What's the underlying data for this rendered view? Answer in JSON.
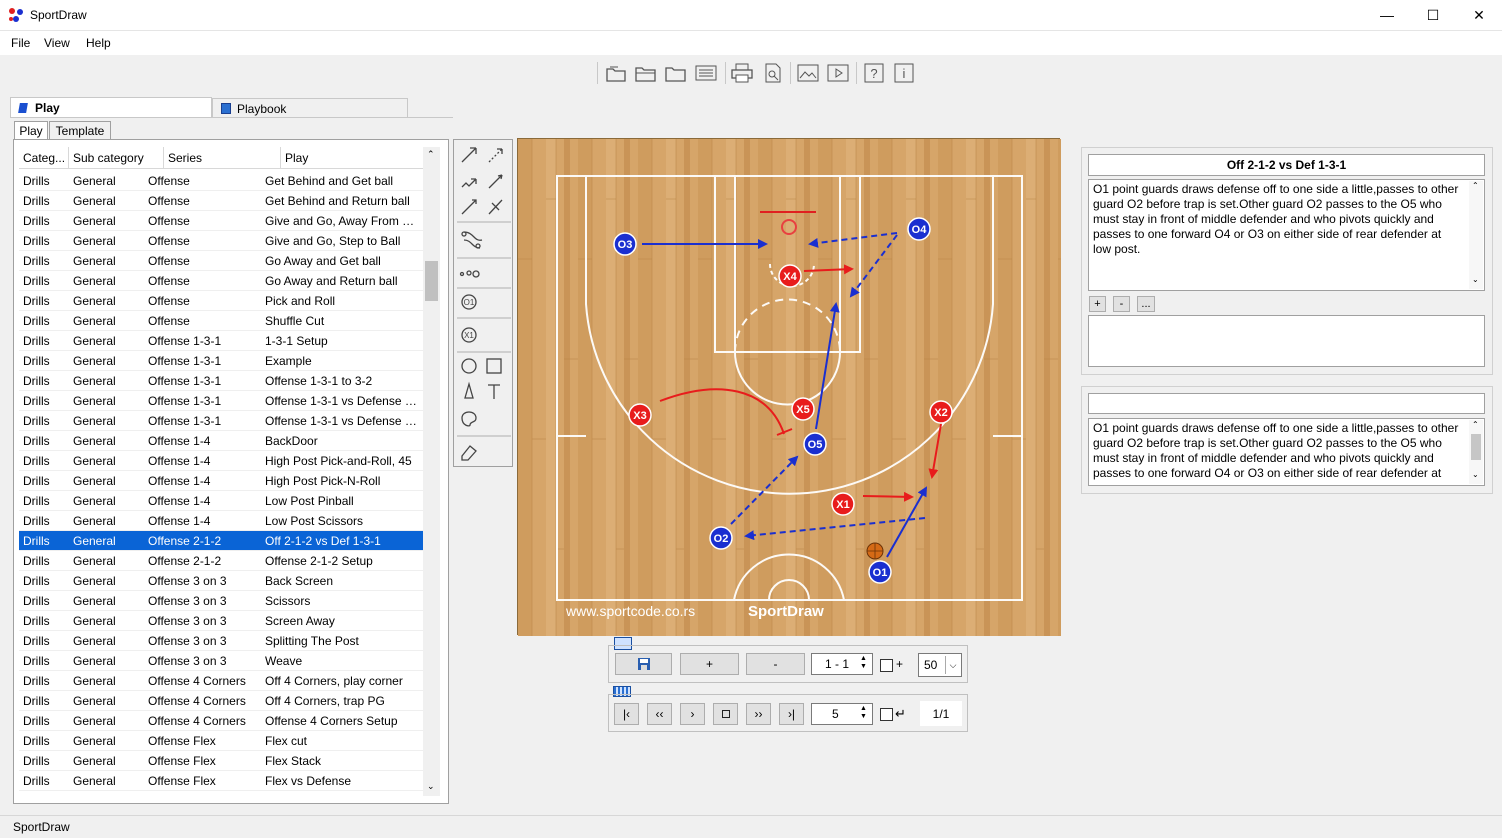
{
  "window": {
    "title": "SportDraw"
  },
  "menu": [
    "File",
    "View",
    "Help"
  ],
  "tabs": {
    "outer": [
      "Play",
      "Playbook"
    ],
    "inner": [
      "Play",
      "Template"
    ]
  },
  "list": {
    "columns": [
      "Categ...",
      "Sub category",
      "Series",
      "Play"
    ],
    "rows": [
      [
        "Drills",
        "General",
        "Offense",
        "Get Behind and Get ball"
      ],
      [
        "Drills",
        "General",
        "Offense",
        "Get Behind and Return ball"
      ],
      [
        "Drills",
        "General",
        "Offense",
        "Give and Go, Away From Ball"
      ],
      [
        "Drills",
        "General",
        "Offense",
        "Give and Go, Step to Ball"
      ],
      [
        "Drills",
        "General",
        "Offense",
        "Go Away and Get ball"
      ],
      [
        "Drills",
        "General",
        "Offense",
        "Go Away and Return ball"
      ],
      [
        "Drills",
        "General",
        "Offense",
        "Pick and Roll"
      ],
      [
        "Drills",
        "General",
        "Offense",
        "Shuffle Cut"
      ],
      [
        "Drills",
        "General",
        "Offense 1-3-1",
        "1-3-1 Setup"
      ],
      [
        "Drills",
        "General",
        "Offense 1-3-1",
        "Example"
      ],
      [
        "Drills",
        "General",
        "Offense 1-3-1",
        "Offense 1-3-1 to 3-2"
      ],
      [
        "Drills",
        "General",
        "Offense 1-3-1",
        "Offense 1-3-1 vs Defense 2-..."
      ],
      [
        "Drills",
        "General",
        "Offense 1-3-1",
        "Offense 1-3-1 vs Defense 3-..."
      ],
      [
        "Drills",
        "General",
        "Offense 1-4",
        "BackDoor"
      ],
      [
        "Drills",
        "General",
        "Offense 1-4",
        "High Post Pick-and-Roll, 45"
      ],
      [
        "Drills",
        "General",
        "Offense 1-4",
        "High Post Pick-N-Roll"
      ],
      [
        "Drills",
        "General",
        "Offense 1-4",
        "Low Post Pinball"
      ],
      [
        "Drills",
        "General",
        "Offense 1-4",
        "Low Post Scissors"
      ],
      [
        "Drills",
        "General",
        "Offense 2-1-2",
        "Off  2-1-2 vs Def 1-3-1"
      ],
      [
        "Drills",
        "General",
        "Offense 2-1-2",
        "Offense 2-1-2 Setup"
      ],
      [
        "Drills",
        "General",
        "Offense 3 on 3",
        "Back Screen"
      ],
      [
        "Drills",
        "General",
        "Offense 3 on 3",
        "Scissors"
      ],
      [
        "Drills",
        "General",
        "Offense 3 on 3",
        "Screen Away"
      ],
      [
        "Drills",
        "General",
        "Offense 3 on 3",
        "Splitting The Post"
      ],
      [
        "Drills",
        "General",
        "Offense 3 on 3",
        "Weave"
      ],
      [
        "Drills",
        "General",
        "Offense 4 Corners",
        "Off 4 Corners, play corner"
      ],
      [
        "Drills",
        "General",
        "Offense 4 Corners",
        "Off 4 Corners, trap PG"
      ],
      [
        "Drills",
        "General",
        "Offense 4 Corners",
        "Offense 4 Corners Setup"
      ],
      [
        "Drills",
        "General",
        "Offense Flex",
        "Flex cut"
      ],
      [
        "Drills",
        "General",
        "Offense Flex",
        "Flex Stack"
      ],
      [
        "Drills",
        "General",
        "Offense Flex",
        "Flex vs Defense"
      ]
    ],
    "selected_play": "Off  2-1-2 vs Def 1-3-1"
  },
  "court": {
    "watermark_left": "www.sportcode.co.rs",
    "watermark_right": "SportDraw",
    "players": {
      "O1": "O1",
      "O2": "O2",
      "O3": "O3",
      "O4": "O4",
      "O5": "O5",
      "X1": "X1",
      "X2": "X2",
      "X3": "X3",
      "X4": "X4",
      "X5": "X5"
    }
  },
  "controls": {
    "add_label": "+",
    "remove_label": "-",
    "frame_value": "1 - 1",
    "plus_check_label": "+",
    "zoom_value": "50",
    "speed_value": "5",
    "page_value": "1/1"
  },
  "right_panel": {
    "title": "Off  2-1-2 vs Def 1-3-1",
    "description": "O1 point guards draws defense off to one side a little,passes to other guard O2 before trap is set.Other guard O2 passes to the O5 who must stay in front of middle defender and who pivots quickly and passes to one forward O4 or O3 on either side of rear defender at low post.",
    "small_buttons": [
      "+",
      "-",
      "..."
    ],
    "frame_title": "",
    "frame_description": "O1 point guards draws defense off to one side a little,passes to other guard O2 before trap is set.Other guard O2 passes to the O5 who must stay in front of middle defender and who pivots quickly and passes to one forward O4 or O3 on either side of rear defender at"
  },
  "status": "SportDraw",
  "colors": {
    "selection": "#0a64d6",
    "offense": "#1a2fd0",
    "defense": "#e81c1c",
    "court_wood": "#d8a56a"
  }
}
